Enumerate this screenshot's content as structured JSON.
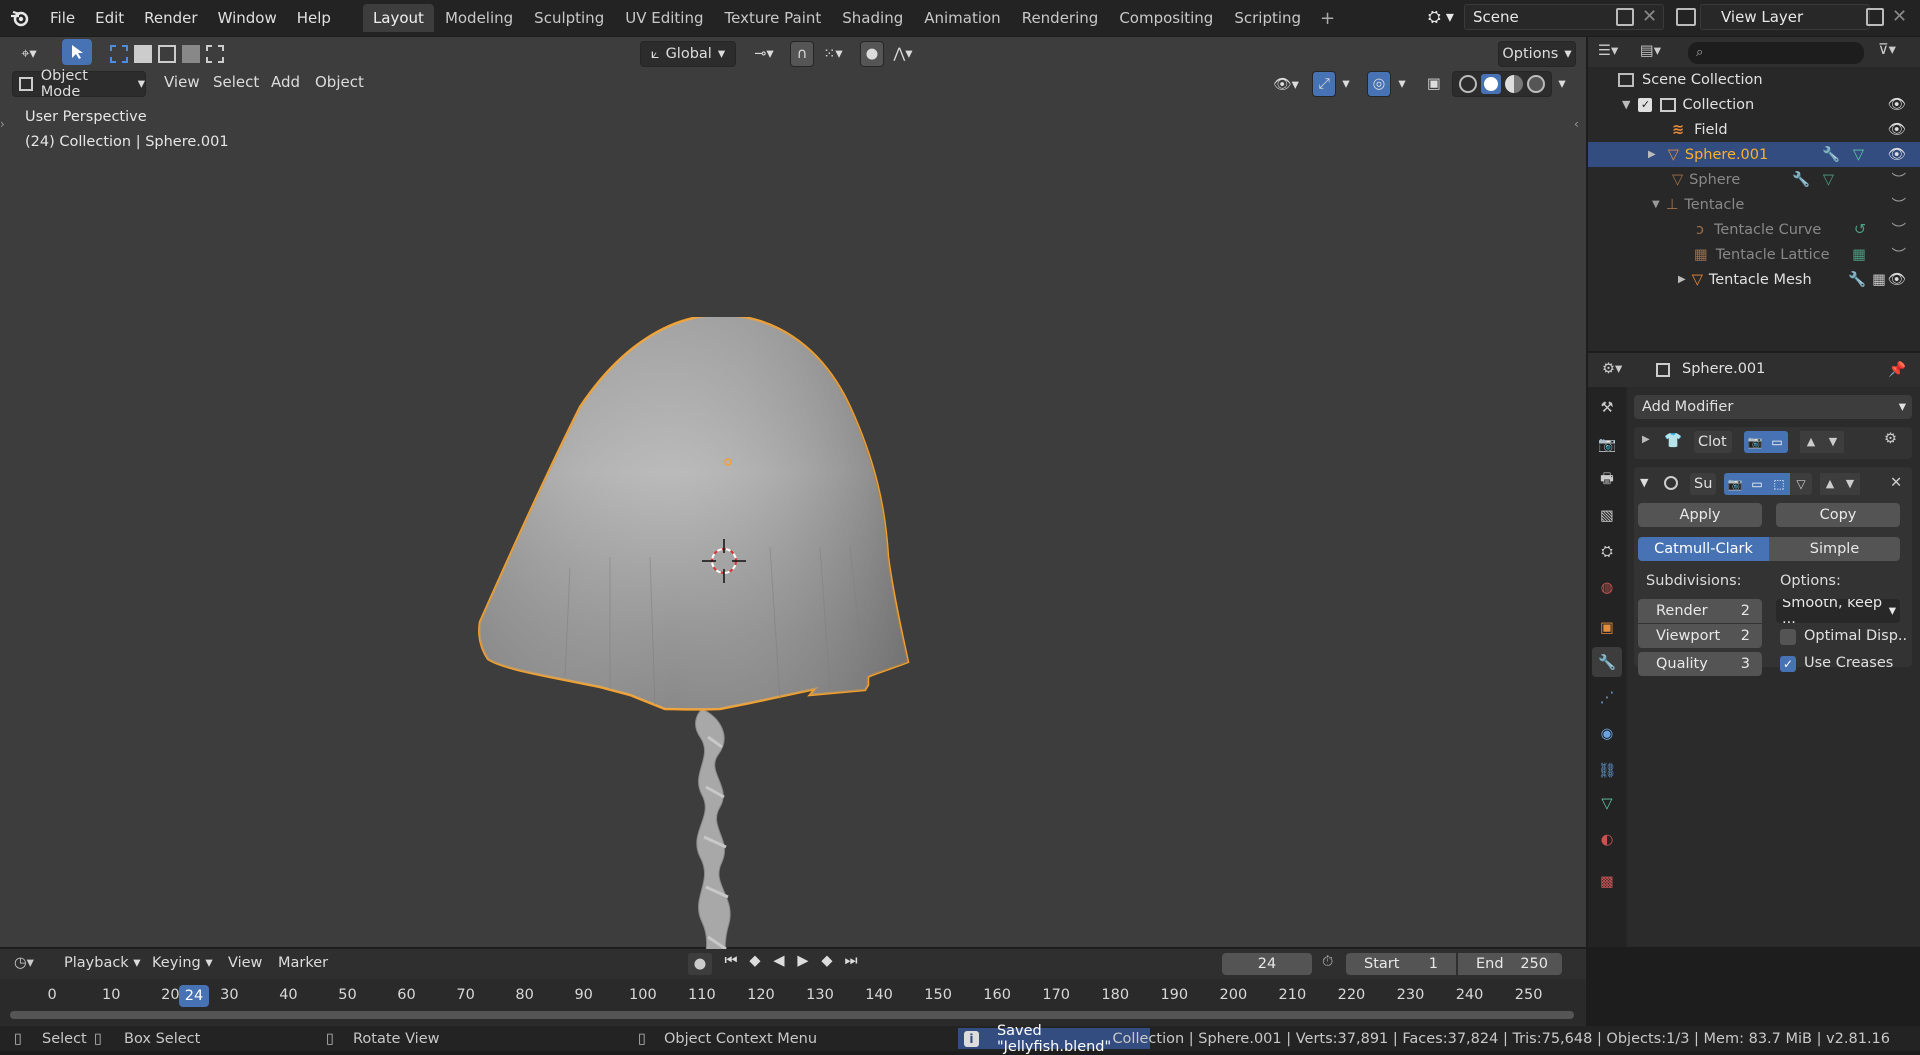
{
  "menu": [
    "File",
    "Edit",
    "Render",
    "Window",
    "Help"
  ],
  "workspaces": [
    "Layout",
    "Modeling",
    "Sculpting",
    "UV Editing",
    "Texture Paint",
    "Shading",
    "Animation",
    "Rendering",
    "Compositing",
    "Scripting"
  ],
  "scene": "Scene",
  "view_layer": "View Layer",
  "viewport": {
    "mode": "Object Mode",
    "menus": [
      "View",
      "Select",
      "Add",
      "Object"
    ],
    "orientation": "Global",
    "options": "Options",
    "perspective": "User Perspective",
    "context": "(24) Collection | Sphere.001"
  },
  "outliner": {
    "root": "Scene Collection",
    "items": [
      {
        "name": "Collection"
      },
      {
        "name": "Field"
      },
      {
        "name": "Sphere.001"
      },
      {
        "name": "Sphere"
      },
      {
        "name": "Tentacle"
      },
      {
        "name": "Tentacle Curve"
      },
      {
        "name": "Tentacle Lattice"
      },
      {
        "name": "Tentacle Mesh"
      }
    ]
  },
  "properties": {
    "object": "Sphere.001",
    "add_modifier": "Add Modifier",
    "mod1_name": "Clot",
    "mod2_name": "Su",
    "apply": "Apply",
    "copy": "Copy",
    "catmull": "Catmull-Clark",
    "simple": "Simple",
    "subdivisions": "Subdivisions:",
    "options": "Options:",
    "render_label": "Render",
    "render_val": "2",
    "viewport_label": "Viewport",
    "viewport_val": "2",
    "quality_label": "Quality",
    "quality_val": "3",
    "smooth": "Smooth, keep ...",
    "optimal": "Optimal Disp..",
    "use_creases": "Use Creases"
  },
  "timeline": {
    "menus": [
      "Playback",
      "Keying",
      "View",
      "Marker"
    ],
    "current_frame": "24",
    "start_label": "Start",
    "start": "1",
    "end_label": "End",
    "end": "250",
    "ticks": [
      "0",
      "10",
      "20",
      "30",
      "40",
      "50",
      "60",
      "70",
      "80",
      "90",
      "100",
      "110",
      "120",
      "130",
      "140",
      "150",
      "160",
      "170",
      "180",
      "190",
      "200",
      "210",
      "220",
      "230",
      "240",
      "250"
    ]
  },
  "status": {
    "select": "Select",
    "box_select": "Box Select",
    "rotate": "Rotate View",
    "context_menu": "Object Context Menu",
    "saved": "Saved \"Jellyfish.blend\"",
    "stats": "Collection | Sphere.001 | Verts:37,891 | Faces:37,824 | Tris:75,648 | Objects:1/3 | Mem: 83.7 MiB | v2.81.16"
  },
  "colors": {
    "accent": "#4772b3",
    "selected": "#ffaf29"
  }
}
